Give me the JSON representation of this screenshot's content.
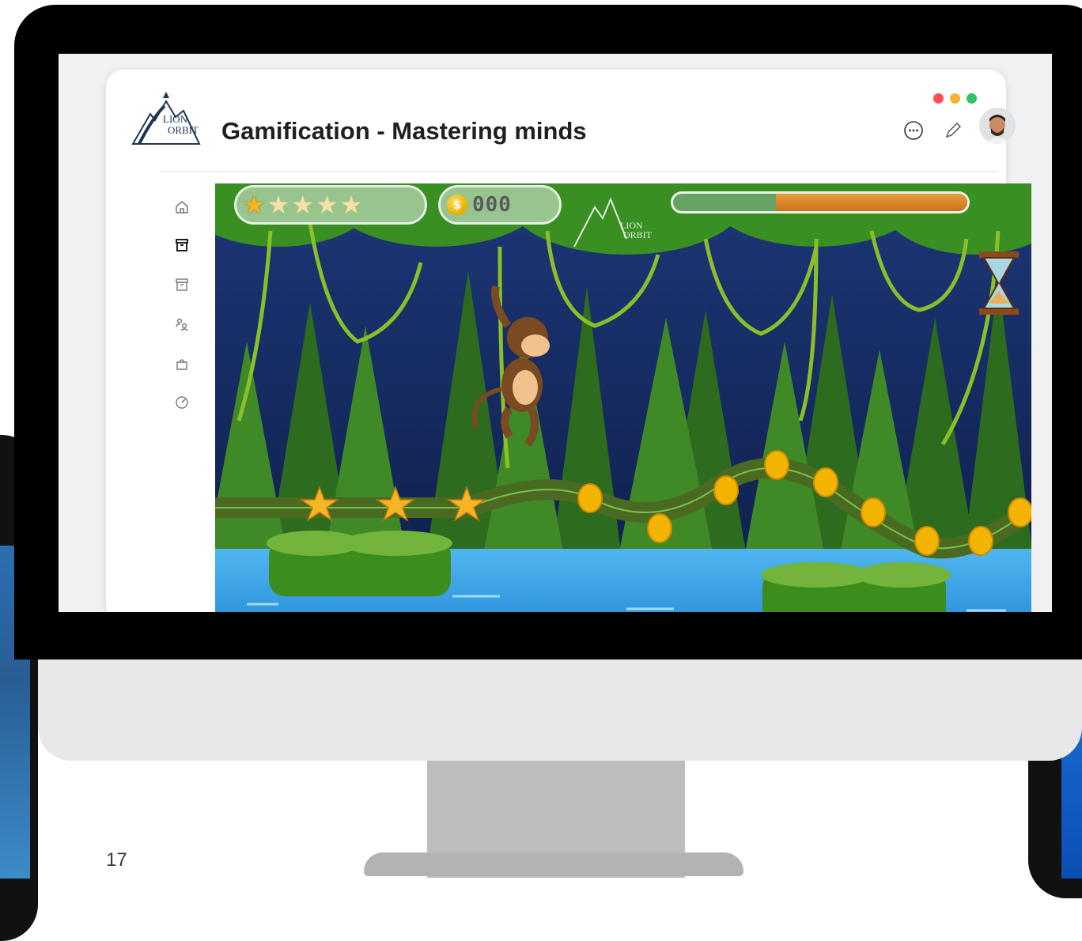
{
  "app": {
    "title": "Gamification - Mastering minds",
    "logo_text_top": "LION",
    "logo_text_bottom": "ORBIT",
    "window_controls": [
      "#ff4c5b",
      "#f9b233",
      "#2fc464"
    ]
  },
  "header": {
    "icons": [
      "chat-icon",
      "pencil-icon",
      "user-avatar"
    ]
  },
  "sidebar": {
    "items": [
      {
        "icon": "home-icon"
      },
      {
        "icon": "archive-box-icon",
        "active": true
      },
      {
        "icon": "archive-box-outline-icon"
      },
      {
        "icon": "users-group-icon"
      },
      {
        "icon": "shopping-bag-icon"
      },
      {
        "icon": "speedometer-icon"
      }
    ]
  },
  "game": {
    "stars_total": 5,
    "stars_earned": 1,
    "coin_count": "000",
    "coin_symbol": "$",
    "timer_fraction_remaining": 0.65,
    "watermark_top": "LION",
    "watermark_bottom": "ORBIT"
  },
  "slide": {
    "page_number": "17"
  }
}
